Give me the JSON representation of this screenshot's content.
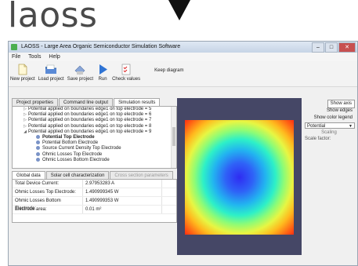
{
  "brand": {
    "text": "laoss"
  },
  "window": {
    "title": "LAOSS - Large Area Organic Semiconductor Simulation Software",
    "controls": {
      "minimize": "–",
      "maximize": "□",
      "close": "✕"
    }
  },
  "menu": [
    "File",
    "Tools",
    "Help"
  ],
  "toolbar": {
    "buttons": [
      {
        "label": "New project",
        "icon": "new-document-icon"
      },
      {
        "label": "Load project",
        "icon": "folder-icon"
      },
      {
        "label": "Save project",
        "icon": "save-icon"
      },
      {
        "label": "Run",
        "icon": "play-icon"
      },
      {
        "label": "Check values",
        "icon": "checklist-icon"
      }
    ],
    "keep_diagram": "Keep diagram"
  },
  "tabs": [
    "Project properties",
    "Command line output",
    "Simulation results"
  ],
  "tree": {
    "parents": [
      "Potential applied on boundaries edge1 on top electrode = 5",
      "Potential applied on boundaries edge1 on top electrode = 6",
      "Potential applied on boundaries edge1 on top electrode = 7",
      "Potential applied on boundaries edge1 on top electrode = 8",
      "Potential applied on boundaries edge1 on top electrode = 9"
    ],
    "children": [
      "Potential Top Electrode",
      "Potential Bottom Electrode",
      "Source Current Density Top Electrode",
      "Ohmic Losses Top Electrode",
      "Ohmic Losses Bottom Electrode"
    ]
  },
  "bottom_tabs": [
    "Global data",
    "Solar cell characterization",
    "Cross section parameters"
  ],
  "global_data": [
    {
      "label": "Total Device Current:",
      "value": "2.97953283 A"
    },
    {
      "label": "Ohmic Losses Top Electrode:",
      "value": "1.490999345 W"
    },
    {
      "label": "Ohmic Losses Bottom Electrode:",
      "value": "1.490999353 W"
    },
    {
      "label": "Electrode area:",
      "value": "0.01 m²"
    }
  ],
  "right_panel": {
    "show_axis": "Show axis",
    "show_edges": "Show edges",
    "show_color_legend": "Show color legend",
    "select_value": "Potential",
    "scaling": "Scaling",
    "scale_factor": "Scale factor:"
  }
}
